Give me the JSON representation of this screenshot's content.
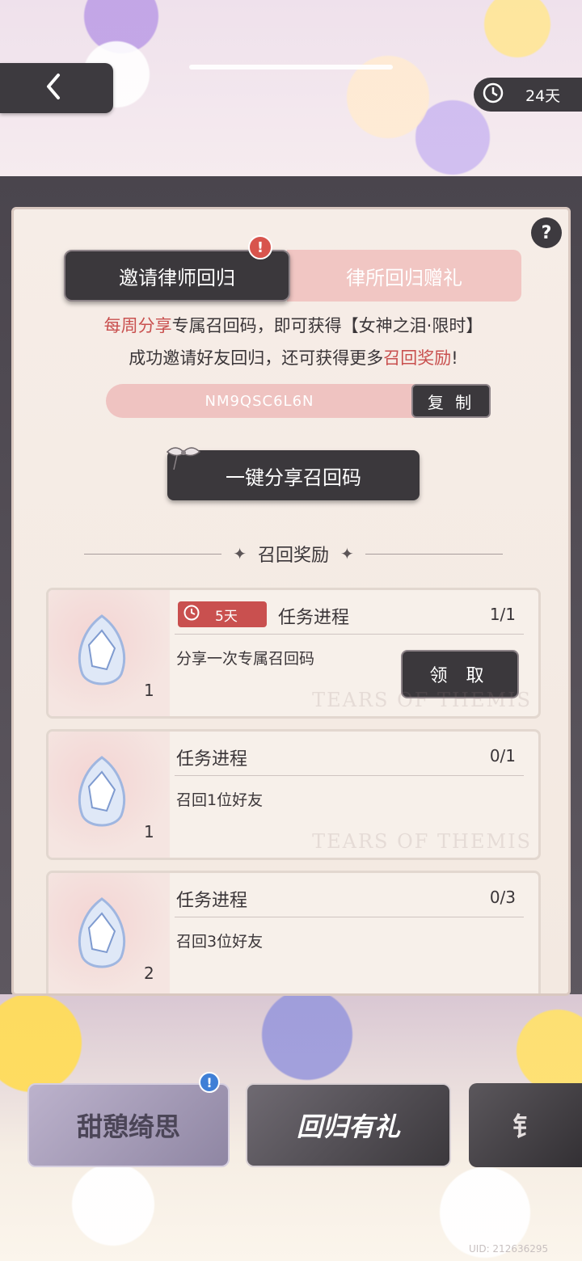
{
  "header": {
    "back_icon": "chevron-left-icon",
    "timer_icon": "clock-icon",
    "timer_text": "24天"
  },
  "tabs": {
    "invite_label": "邀请律师回归",
    "gift_label": "律所回归赠礼",
    "invite_alert": "!"
  },
  "help": {
    "label": "?"
  },
  "description": {
    "line1_highlight": "每周分享",
    "line1_text": "专属召回码，即可获得【女神之泪·限时】",
    "line2_text": "成功邀请好友回归，还可获得更多",
    "line2_highlight": "召回奖励",
    "line2_end": "!"
  },
  "code": {
    "value": "NM9QSC6L6N",
    "copy_label": "复 制"
  },
  "share_button": {
    "label": "一键分享召回码"
  },
  "rewards": {
    "section_title": "召回奖励",
    "watermark": "TEARS OF THEMIS",
    "items": [
      {
        "timer": "5天",
        "title": "任务进程",
        "progress": "1/1",
        "desc": "分享一次专属召回码",
        "count": "1",
        "claim_label": "领 取"
      },
      {
        "title": "任务进程",
        "progress": "0/1",
        "desc": "召回1位好友",
        "count": "1"
      },
      {
        "title": "任务进程",
        "progress": "0/3",
        "desc": "召回3位好友",
        "count": "2"
      }
    ]
  },
  "bottom_tabs": {
    "tab1_label": "甜憩绮思",
    "tab1_badge": "!",
    "tab2_label": "回归有礼",
    "tab3_label": "钅"
  },
  "uid": "UID: 212636295",
  "colors": {
    "accent_red": "#c9504f",
    "dark_button": "#3b383c",
    "pink": "#efc3c1"
  }
}
